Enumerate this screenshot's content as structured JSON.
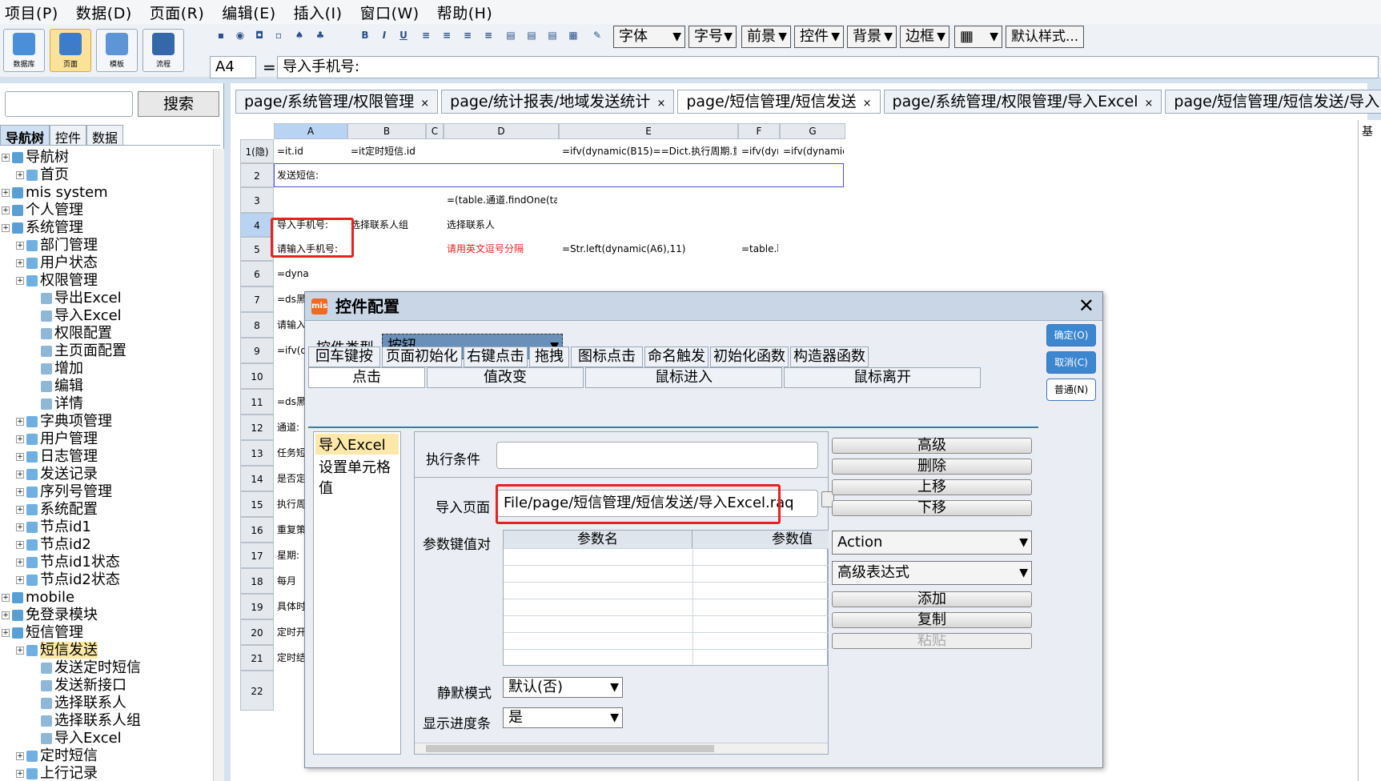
{
  "menu": [
    "项目(P)",
    "数据(D)",
    "页面(R)",
    "编辑(E)",
    "插入(I)",
    "窗口(W)",
    "帮助(H)"
  ],
  "toolbar": {
    "big_buttons": [
      "数据库",
      "页面",
      "模板",
      "流程"
    ],
    "font_combo": "字体",
    "size_combo": "字号",
    "fg_combo": "前景",
    "control_combo": "控件",
    "bg_combo": "背景",
    "border_combo": "边框",
    "default_style_label": "默认样式..."
  },
  "formula": {
    "cell_ref": "A4",
    "eq": "=",
    "value": "导入手机号:"
  },
  "left": {
    "search_label": "搜索",
    "tabs": [
      "导航树",
      "控件",
      "数据"
    ],
    "tree": [
      {
        "label": "导航树",
        "indent": 0
      },
      {
        "label": "首页",
        "indent": 1
      },
      {
        "label": "mis system",
        "indent": 0
      },
      {
        "label": "个人管理",
        "indent": 0
      },
      {
        "label": "系统管理",
        "indent": 0
      },
      {
        "label": "部门管理",
        "indent": 1
      },
      {
        "label": "用户状态",
        "indent": 1
      },
      {
        "label": "权限管理",
        "indent": 1
      },
      {
        "label": "导出Excel",
        "indent": 2
      },
      {
        "label": "导入Excel",
        "indent": 2
      },
      {
        "label": "权限配置",
        "indent": 2
      },
      {
        "label": "主页面配置",
        "indent": 2
      },
      {
        "label": "增加",
        "indent": 2
      },
      {
        "label": "编辑",
        "indent": 2
      },
      {
        "label": "详情",
        "indent": 2
      },
      {
        "label": "字典项管理",
        "indent": 1
      },
      {
        "label": "用户管理",
        "indent": 1
      },
      {
        "label": "日志管理",
        "indent": 1
      },
      {
        "label": "发送记录",
        "indent": 1
      },
      {
        "label": "序列号管理",
        "indent": 1
      },
      {
        "label": "系统配置",
        "indent": 1
      },
      {
        "label": "节点id1",
        "indent": 1
      },
      {
        "label": "节点id2",
        "indent": 1
      },
      {
        "label": "节点id1状态",
        "indent": 1
      },
      {
        "label": "节点id2状态",
        "indent": 1
      },
      {
        "label": "mobile",
        "indent": 0
      },
      {
        "label": "免登录模块",
        "indent": 0
      },
      {
        "label": "短信管理",
        "indent": 0
      },
      {
        "label": "短信发送",
        "indent": 1,
        "selected": true
      },
      {
        "label": "发送定时短信",
        "indent": 2
      },
      {
        "label": "发送新接口",
        "indent": 2
      },
      {
        "label": "选择联系人",
        "indent": 2
      },
      {
        "label": "选择联系人组",
        "indent": 2
      },
      {
        "label": "导入Excel",
        "indent": 2
      },
      {
        "label": "定时短信",
        "indent": 1
      },
      {
        "label": "上行记录",
        "indent": 1
      }
    ]
  },
  "doc_tabs": [
    {
      "label": "page/系统管理/权限管理"
    },
    {
      "label": "page/统计报表/地域发送统计"
    },
    {
      "label": "page/短信管理/短信发送",
      "selected": true
    },
    {
      "label": "page/系统管理/权限管理/导入Excel"
    },
    {
      "label": "page/短信管理/短信发送/导入Excel"
    }
  ],
  "grid": {
    "columns": [
      "A",
      "B",
      "C",
      "D",
      "E",
      "F",
      "G"
    ],
    "rows": [
      "1(隐)",
      "2",
      "3",
      "4",
      "5",
      "6",
      "7",
      "8",
      "9",
      "10",
      "11",
      "12",
      "13",
      "14",
      "15",
      "16",
      "17",
      "18",
      "19",
      "20",
      "21",
      "22"
    ],
    "cells": {
      "r1": [
        "=it.id",
        "=it定时短信.id",
        "",
        "",
        "=ifv(dynamic(B15)==Dict.执行周期.重复&&",
        "=ifv(dyna",
        "=ifv(dynamic(B"
      ],
      "r2": [
        "发送短信:"
      ],
      "r3": [
        "",
        "",
        "",
        "=(table.通道.findOne(table."
      ],
      "r4": [
        "导入手机号:",
        "选择联系人组",
        "",
        "选择联系人"
      ],
      "r5": [
        "请输入手机号:",
        "",
        "",
        "请用英文逗号分隔",
        "=Str.left(dynamic(A6),11)",
        "=table.联"
      ],
      "colA": [
        "=dyna",
        "=ds黑",
        "请输入",
        "=ifv(dy",
        "",
        "=ds黑",
        "通道:",
        "任务短",
        "是否定",
        "执行周",
        "重复策",
        "星期:",
        "每月",
        "具体时",
        "定时开",
        "定时结",
        ""
      ]
    }
  },
  "dialog": {
    "title": "控件配置",
    "logo": "mis",
    "close": "✕",
    "type_label": "控件类型",
    "type_value": "按钮",
    "ok": "确定(O)",
    "cancel": "取消(C)",
    "normal": "普通(N)",
    "tabs_row1": [
      "回车键按下",
      "页面初始化",
      "右键点击",
      "拖拽",
      "图标点击",
      "命名触发",
      "初始化函数",
      "构造器函数"
    ],
    "tabs_row2": [
      "点击",
      "值改变",
      "鼠标进入",
      "鼠标离开"
    ],
    "actions": [
      "导入Excel",
      "设置单元格值"
    ],
    "cond_label": "执行条件",
    "import_label": "导入页面",
    "import_value": "File/page/短信管理/短信发送/导入Excel.raq",
    "params_label": "参数键值对",
    "param_name": "参数名",
    "param_value": "参数值",
    "silent_label": "静默模式",
    "silent_value": "默认(否)",
    "progress_label": "显示进度条",
    "progress_value": "是",
    "right_buttons": [
      "高级",
      "删除",
      "上移",
      "下移"
    ],
    "action_dd": "Action",
    "expr_dd": "高级表达式",
    "add": "添加",
    "copy": "复制",
    "paste": "粘贴"
  },
  "colors": {
    "accent": "#3a78b8",
    "highlight": "#e82020",
    "selected_tree": "#fce8a8",
    "panel": "#d4e1ef"
  },
  "right_strip_label": "基"
}
